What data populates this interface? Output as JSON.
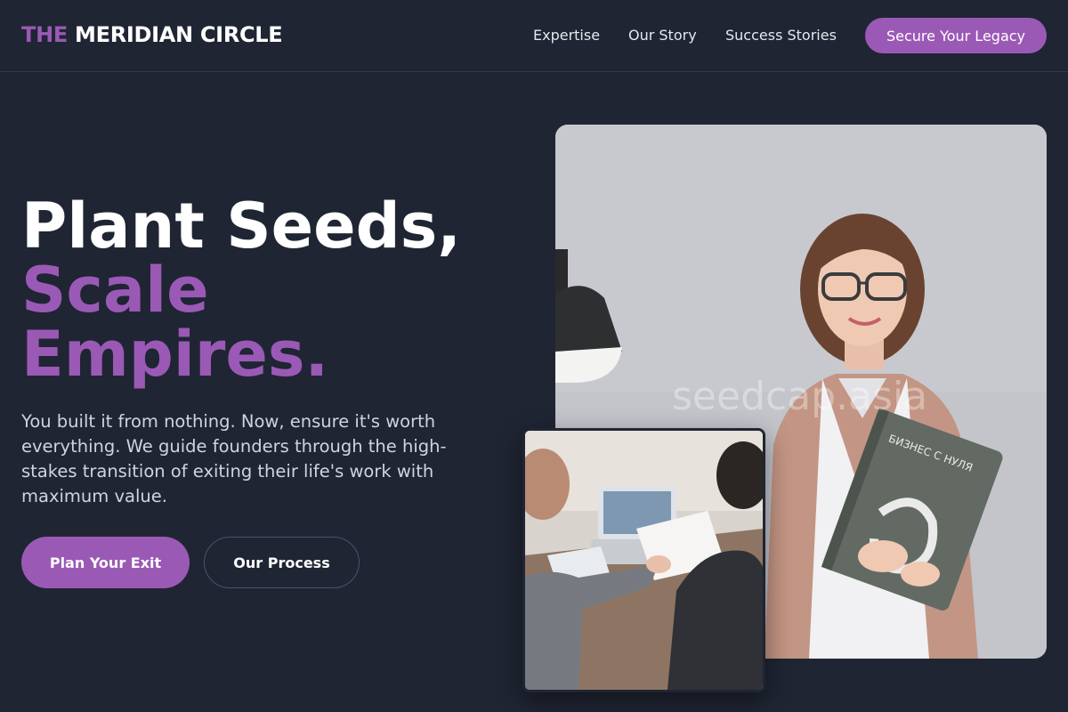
{
  "brand": {
    "accent": "THE",
    "name": "MERIDIAN CIRCLE",
    "accent_color": "#9b59b6"
  },
  "nav": {
    "links": [
      "Expertise",
      "Our Story",
      "Success Stories"
    ],
    "cta": "Secure Your Legacy"
  },
  "hero": {
    "title_line1": "Plant Seeds,",
    "title_line2": "Scale",
    "title_line3": "Empires.",
    "description": "You built it from nothing. Now, ensure it's worth everything. We guide founders through the high-stakes transition of exiting their life's work with maximum value.",
    "primary_button": "Plan Your Exit",
    "secondary_button": "Our Process"
  },
  "images": {
    "watermark": "seedcap.asia",
    "book_title": "БИЗНЕС С НУЛЯ",
    "main_photo_icon": "woman-with-book-photo",
    "secondary_photo_icon": "meeting-photo"
  },
  "colors": {
    "background": "#1f2533",
    "accent": "#9b59b6",
    "text_muted": "#cfd4de"
  }
}
